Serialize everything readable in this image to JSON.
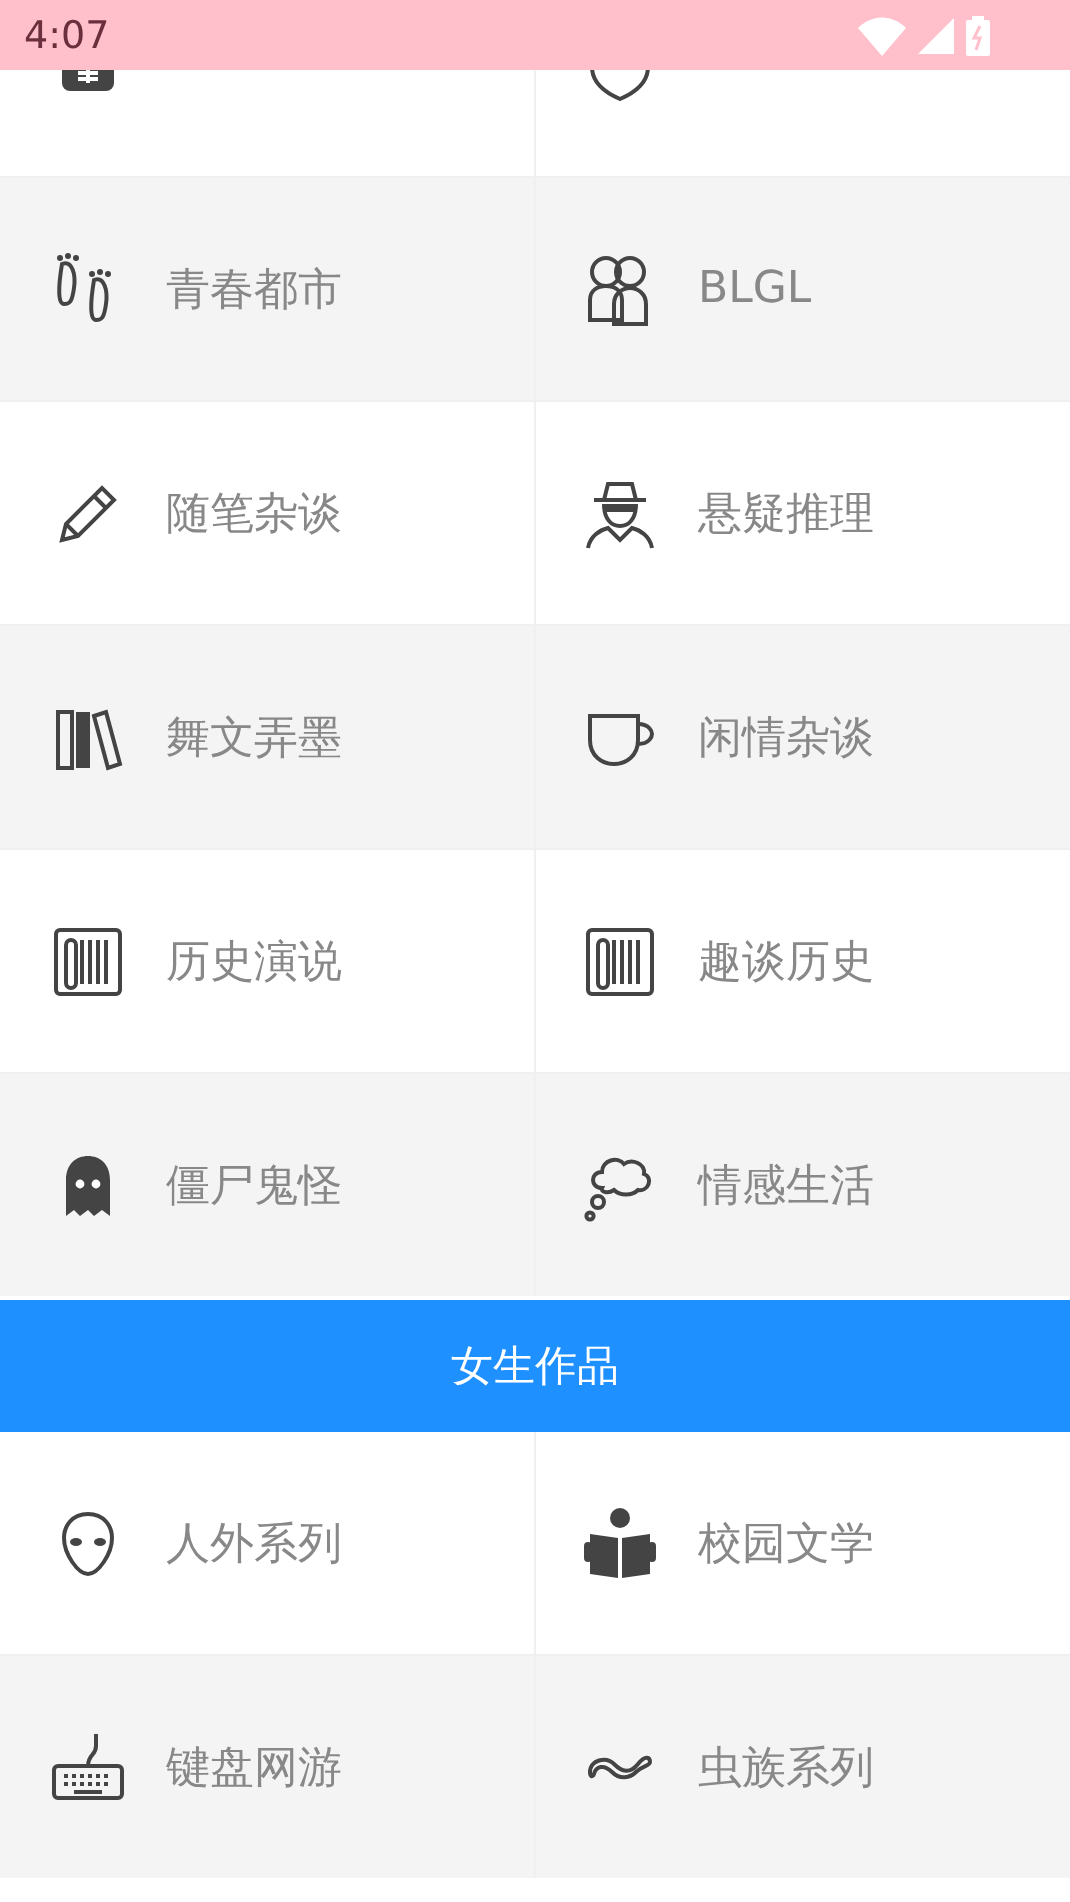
{
  "status_bar": {
    "time": "4:07"
  },
  "sections": [
    {
      "kind": "grid",
      "items": [
        {
          "kind": "cut"
        },
        {
          "kind": "cut"
        },
        {
          "kind": "full",
          "label": "青春都市"
        },
        {
          "kind": "full",
          "label": "BLGL"
        },
        {
          "kind": "full",
          "label": "随笔杂谈"
        },
        {
          "kind": "full",
          "label": "悬疑推理"
        },
        {
          "kind": "full",
          "label": "舞文弄墨"
        },
        {
          "kind": "full",
          "label": "闲情杂谈"
        },
        {
          "kind": "full",
          "label": "历史演说"
        },
        {
          "kind": "full",
          "label": "趣谈历史"
        },
        {
          "kind": "full",
          "label": "僵尸鬼怪"
        },
        {
          "kind": "full",
          "label": "情感生活"
        }
      ]
    },
    {
      "kind": "header",
      "title": "女生作品"
    },
    {
      "kind": "grid",
      "items": [
        {
          "kind": "full",
          "label": "人外系列"
        },
        {
          "kind": "full",
          "label": "校园文学"
        },
        {
          "kind": "full",
          "label": "键盘网游"
        },
        {
          "kind": "full",
          "label": "虫族系列"
        }
      ]
    }
  ]
}
